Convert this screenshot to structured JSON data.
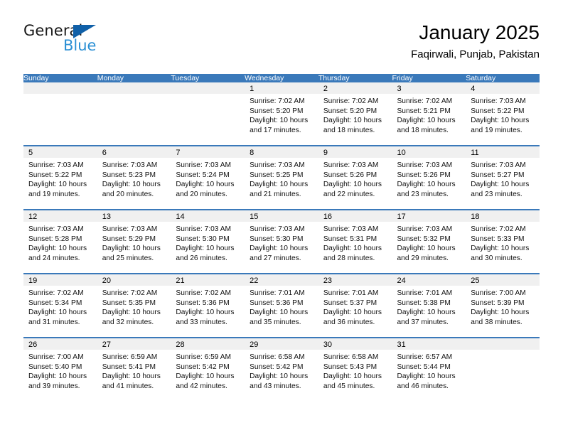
{
  "logo": {
    "word_dark": "General",
    "word_blue": "Blue",
    "triangle_color": "#1060a8",
    "blue_color": "#2a8fd4"
  },
  "header": {
    "title": "January 2025",
    "subtitle": "Faqirwali, Punjab, Pakistan"
  },
  "theme": {
    "header_bg": "#3a79ba",
    "daynum_bg": "#f0f0f0",
    "cell_bg": "#ffffff",
    "separator": "#3a79ba"
  },
  "weekday_headers": [
    "Sunday",
    "Monday",
    "Tuesday",
    "Wednesday",
    "Thursday",
    "Friday",
    "Saturday"
  ],
  "weeks": [
    [
      {
        "day": "",
        "sunrise": "",
        "sunset": "",
        "daylight1": "",
        "daylight2": ""
      },
      {
        "day": "",
        "sunrise": "",
        "sunset": "",
        "daylight1": "",
        "daylight2": ""
      },
      {
        "day": "",
        "sunrise": "",
        "sunset": "",
        "daylight1": "",
        "daylight2": ""
      },
      {
        "day": "1",
        "sunrise": "Sunrise: 7:02 AM",
        "sunset": "Sunset: 5:20 PM",
        "daylight1": "Daylight: 10 hours",
        "daylight2": "and 17 minutes."
      },
      {
        "day": "2",
        "sunrise": "Sunrise: 7:02 AM",
        "sunset": "Sunset: 5:20 PM",
        "daylight1": "Daylight: 10 hours",
        "daylight2": "and 18 minutes."
      },
      {
        "day": "3",
        "sunrise": "Sunrise: 7:02 AM",
        "sunset": "Sunset: 5:21 PM",
        "daylight1": "Daylight: 10 hours",
        "daylight2": "and 18 minutes."
      },
      {
        "day": "4",
        "sunrise": "Sunrise: 7:03 AM",
        "sunset": "Sunset: 5:22 PM",
        "daylight1": "Daylight: 10 hours",
        "daylight2": "and 19 minutes."
      }
    ],
    [
      {
        "day": "5",
        "sunrise": "Sunrise: 7:03 AM",
        "sunset": "Sunset: 5:22 PM",
        "daylight1": "Daylight: 10 hours",
        "daylight2": "and 19 minutes."
      },
      {
        "day": "6",
        "sunrise": "Sunrise: 7:03 AM",
        "sunset": "Sunset: 5:23 PM",
        "daylight1": "Daylight: 10 hours",
        "daylight2": "and 20 minutes."
      },
      {
        "day": "7",
        "sunrise": "Sunrise: 7:03 AM",
        "sunset": "Sunset: 5:24 PM",
        "daylight1": "Daylight: 10 hours",
        "daylight2": "and 20 minutes."
      },
      {
        "day": "8",
        "sunrise": "Sunrise: 7:03 AM",
        "sunset": "Sunset: 5:25 PM",
        "daylight1": "Daylight: 10 hours",
        "daylight2": "and 21 minutes."
      },
      {
        "day": "9",
        "sunrise": "Sunrise: 7:03 AM",
        "sunset": "Sunset: 5:26 PM",
        "daylight1": "Daylight: 10 hours",
        "daylight2": "and 22 minutes."
      },
      {
        "day": "10",
        "sunrise": "Sunrise: 7:03 AM",
        "sunset": "Sunset: 5:26 PM",
        "daylight1": "Daylight: 10 hours",
        "daylight2": "and 23 minutes."
      },
      {
        "day": "11",
        "sunrise": "Sunrise: 7:03 AM",
        "sunset": "Sunset: 5:27 PM",
        "daylight1": "Daylight: 10 hours",
        "daylight2": "and 23 minutes."
      }
    ],
    [
      {
        "day": "12",
        "sunrise": "Sunrise: 7:03 AM",
        "sunset": "Sunset: 5:28 PM",
        "daylight1": "Daylight: 10 hours",
        "daylight2": "and 24 minutes."
      },
      {
        "day": "13",
        "sunrise": "Sunrise: 7:03 AM",
        "sunset": "Sunset: 5:29 PM",
        "daylight1": "Daylight: 10 hours",
        "daylight2": "and 25 minutes."
      },
      {
        "day": "14",
        "sunrise": "Sunrise: 7:03 AM",
        "sunset": "Sunset: 5:30 PM",
        "daylight1": "Daylight: 10 hours",
        "daylight2": "and 26 minutes."
      },
      {
        "day": "15",
        "sunrise": "Sunrise: 7:03 AM",
        "sunset": "Sunset: 5:30 PM",
        "daylight1": "Daylight: 10 hours",
        "daylight2": "and 27 minutes."
      },
      {
        "day": "16",
        "sunrise": "Sunrise: 7:03 AM",
        "sunset": "Sunset: 5:31 PM",
        "daylight1": "Daylight: 10 hours",
        "daylight2": "and 28 minutes."
      },
      {
        "day": "17",
        "sunrise": "Sunrise: 7:03 AM",
        "sunset": "Sunset: 5:32 PM",
        "daylight1": "Daylight: 10 hours",
        "daylight2": "and 29 minutes."
      },
      {
        "day": "18",
        "sunrise": "Sunrise: 7:02 AM",
        "sunset": "Sunset: 5:33 PM",
        "daylight1": "Daylight: 10 hours",
        "daylight2": "and 30 minutes."
      }
    ],
    [
      {
        "day": "19",
        "sunrise": "Sunrise: 7:02 AM",
        "sunset": "Sunset: 5:34 PM",
        "daylight1": "Daylight: 10 hours",
        "daylight2": "and 31 minutes."
      },
      {
        "day": "20",
        "sunrise": "Sunrise: 7:02 AM",
        "sunset": "Sunset: 5:35 PM",
        "daylight1": "Daylight: 10 hours",
        "daylight2": "and 32 minutes."
      },
      {
        "day": "21",
        "sunrise": "Sunrise: 7:02 AM",
        "sunset": "Sunset: 5:36 PM",
        "daylight1": "Daylight: 10 hours",
        "daylight2": "and 33 minutes."
      },
      {
        "day": "22",
        "sunrise": "Sunrise: 7:01 AM",
        "sunset": "Sunset: 5:36 PM",
        "daylight1": "Daylight: 10 hours",
        "daylight2": "and 35 minutes."
      },
      {
        "day": "23",
        "sunrise": "Sunrise: 7:01 AM",
        "sunset": "Sunset: 5:37 PM",
        "daylight1": "Daylight: 10 hours",
        "daylight2": "and 36 minutes."
      },
      {
        "day": "24",
        "sunrise": "Sunrise: 7:01 AM",
        "sunset": "Sunset: 5:38 PM",
        "daylight1": "Daylight: 10 hours",
        "daylight2": "and 37 minutes."
      },
      {
        "day": "25",
        "sunrise": "Sunrise: 7:00 AM",
        "sunset": "Sunset: 5:39 PM",
        "daylight1": "Daylight: 10 hours",
        "daylight2": "and 38 minutes."
      }
    ],
    [
      {
        "day": "26",
        "sunrise": "Sunrise: 7:00 AM",
        "sunset": "Sunset: 5:40 PM",
        "daylight1": "Daylight: 10 hours",
        "daylight2": "and 39 minutes."
      },
      {
        "day": "27",
        "sunrise": "Sunrise: 6:59 AM",
        "sunset": "Sunset: 5:41 PM",
        "daylight1": "Daylight: 10 hours",
        "daylight2": "and 41 minutes."
      },
      {
        "day": "28",
        "sunrise": "Sunrise: 6:59 AM",
        "sunset": "Sunset: 5:42 PM",
        "daylight1": "Daylight: 10 hours",
        "daylight2": "and 42 minutes."
      },
      {
        "day": "29",
        "sunrise": "Sunrise: 6:58 AM",
        "sunset": "Sunset: 5:42 PM",
        "daylight1": "Daylight: 10 hours",
        "daylight2": "and 43 minutes."
      },
      {
        "day": "30",
        "sunrise": "Sunrise: 6:58 AM",
        "sunset": "Sunset: 5:43 PM",
        "daylight1": "Daylight: 10 hours",
        "daylight2": "and 45 minutes."
      },
      {
        "day": "31",
        "sunrise": "Sunrise: 6:57 AM",
        "sunset": "Sunset: 5:44 PM",
        "daylight1": "Daylight: 10 hours",
        "daylight2": "and 46 minutes."
      },
      {
        "day": "",
        "sunrise": "",
        "sunset": "",
        "daylight1": "",
        "daylight2": ""
      }
    ]
  ]
}
